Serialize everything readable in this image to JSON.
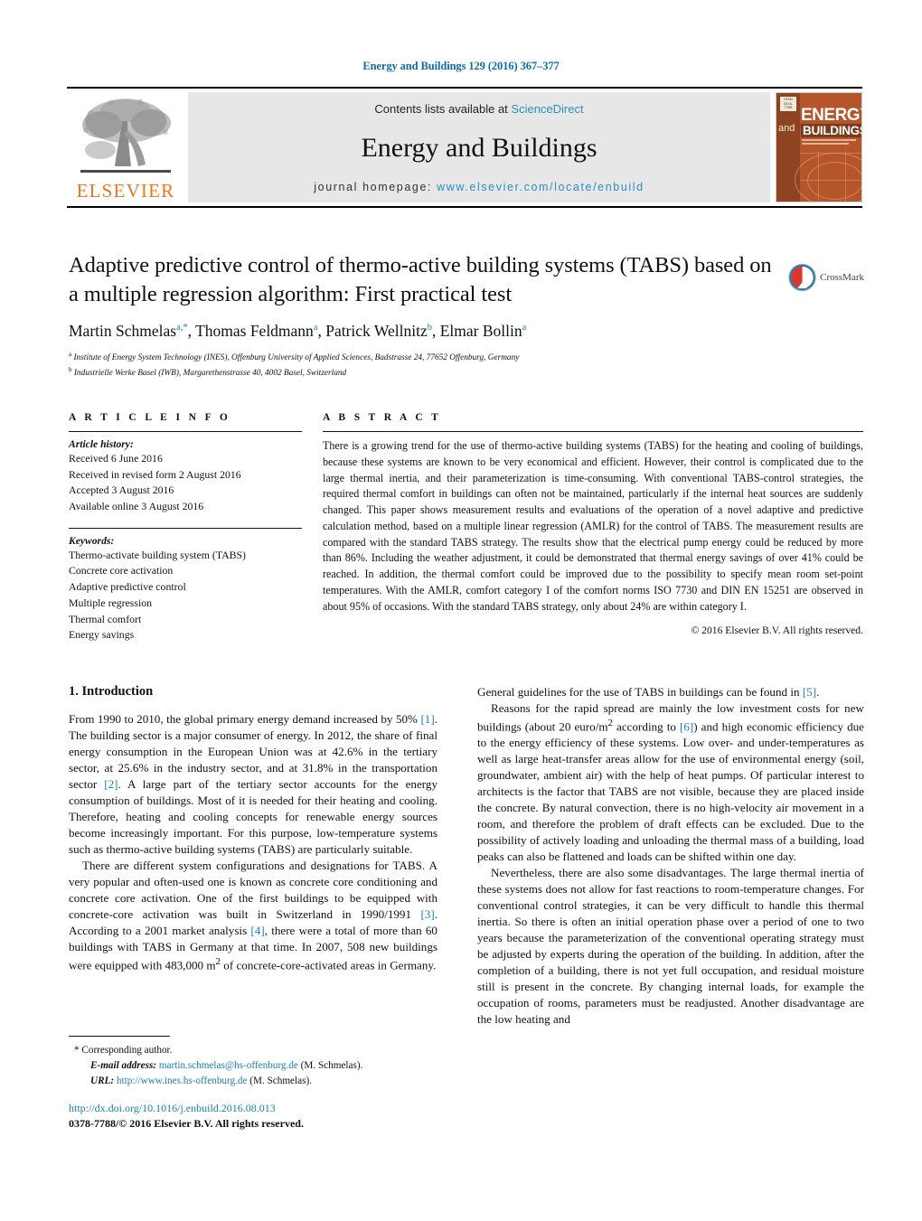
{
  "running_head": "Energy and Buildings 129 (2016) 367–377",
  "masthead": {
    "contents_prefix": "Contents lists available at ",
    "sciencedirect": "ScienceDirect",
    "journal_name": "Energy and Buildings",
    "homepage_label": "journal homepage: ",
    "homepage_url": "www.elsevier.com/locate/enbuild",
    "publisher": "ELSEVIER",
    "cover": {
      "and": "and",
      "energy": "ENERGY",
      "buildings": "BUILDINGS",
      "badge": "ISSN 0378-7788"
    },
    "accent_orange": "#E87722",
    "accent_link": "#2a8fc4"
  },
  "article": {
    "title": "Adaptive predictive control of thermo-active building systems (TABS) based on a multiple regression algorithm: First practical test",
    "authors": [
      {
        "name": "Martin Schmelas",
        "marks": "a,*"
      },
      {
        "name": "Thomas Feldmann",
        "marks": "a"
      },
      {
        "name": "Patrick Wellnitz",
        "marks": "b"
      },
      {
        "name": "Elmar Bollin",
        "marks": "a"
      }
    ],
    "affiliations": [
      {
        "mark": "a",
        "text": "Institute of Energy System Technology (INES), Offenburg University of Applied Sciences, Badstrasse 24, 77652 Offenburg, Germany"
      },
      {
        "mark": "b",
        "text": "Industrielle Werke Basel (IWB), Margarethenstrasse 40, 4002 Basel, Switzerland"
      }
    ],
    "crossmark_label": "CrossMark"
  },
  "article_info": {
    "section_label": "A R T I C L E   I N F O",
    "history_label": "Article history:",
    "history": [
      "Received 6 June 2016",
      "Received in revised form 2 August 2016",
      "Accepted 3 August 2016",
      "Available online 3 August 2016"
    ],
    "keywords_label": "Keywords:",
    "keywords": [
      "Thermo-activate building system (TABS)",
      "Concrete core activation",
      "Adaptive predictive control",
      "Multiple regression",
      "Thermal comfort",
      "Energy savings"
    ]
  },
  "abstract": {
    "section_label": "A B S T R A C T",
    "text": "There is a growing trend for the use of thermo-active building systems (TABS) for the heating and cooling of buildings, because these systems are known to be very economical and efficient. However, their control is complicated due to the large thermal inertia, and their parameterization is time-consuming. With conventional TABS-control strategies, the required thermal comfort in buildings can often not be maintained, particularly if the internal heat sources are suddenly changed. This paper shows measurement results and evaluations of the operation of a novel adaptive and predictive calculation method, based on a multiple linear regression (AMLR) for the control of TABS. The measurement results are compared with the standard TABS strategy. The results show that the electrical pump energy could be reduced by more than 86%. Including the weather adjustment, it could be demonstrated that thermal energy savings of over 41% could be reached. In addition, the thermal comfort could be improved due to the possibility to specify mean room set-point temperatures. With the AMLR, comfort category I of the comfort norms ISO 7730 and DIN EN 15251 are observed in about 95% of occasions. With the standard TABS strategy, only about 24% are within category I.",
    "copyright": "© 2016 Elsevier B.V. All rights reserved."
  },
  "body": {
    "section_number_title": "1.  Introduction",
    "left_paragraphs": [
      "From 1990 to 2010, the global primary energy demand increased by 50% [1]. The building sector is a major consumer of energy. In 2012, the share of final energy consumption in the European Union was at 42.6% in the tertiary sector, at 25.6% in the industry sector, and at 31.8% in the transportation sector [2]. A large part of the tertiary sector accounts for the energy consumption of buildings. Most of it is needed for their heating and cooling. Therefore, heating and cooling concepts for renewable energy sources become increasingly important. For this purpose, low-temperature systems such as thermo-active building systems (TABS) are particularly suitable.",
      "There are different system configurations and designations for TABS. A very popular and often-used one is known as concrete core conditioning and concrete core activation. One of the first buildings to be equipped with concrete-core activation was built in Switzerland in 1990/1991 [3]. According to a 2001 market analysis [4], there were a total of more than 60 buildings with TABS in Germany at that time. In 2007, 508 new buildings were equipped with 483,000 m2 of concrete-core-activated areas in Germany."
    ],
    "right_paragraphs": [
      "General guidelines for the use of TABS in buildings can be found in [5].",
      "Reasons for the rapid spread are mainly the low investment costs for new buildings (about 20 euro/m2 according to [6]) and high economic efficiency due to the energy efficiency of these systems. Low over- and under-temperatures as well as large heat-transfer areas allow for the use of environmental energy (soil, groundwater, ambient air) with the help of heat pumps. Of particular interest to architects is the factor that TABS are not visible, because they are placed inside the concrete. By natural convection, there is no high-velocity air movement in a room, and therefore the problem of draft effects can be excluded. Due to the possibility of actively loading and unloading the thermal mass of a building, load peaks can also be flattened and loads can be shifted within one day.",
      "Nevertheless, there are also some disadvantages. The large thermal inertia of these systems does not allow for fast reactions to room-temperature changes. For conventional control strategies, it can be very difficult to handle this thermal inertia. So there is often an initial operation phase over a period of one to two years because the parameterization of the conventional operating strategy must be adjusted by experts during the operation of the building. In addition, after the completion of a building, there is not yet full occupation, and residual moisture still is present in the concrete. By changing internal loads, for example the occupation of rooms, parameters must be readjusted. Another disadvantage are the low heating and"
    ]
  },
  "footnote": {
    "corresponding": "* Corresponding author.",
    "email_label": "E-mail address:",
    "email": "martin.schmelas@hs-offenburg.de",
    "email_suffix": "(M. Schmelas).",
    "url_label": "URL:",
    "url": "http://www.ines.hs-offenburg.de",
    "url_suffix": "(M. Schmelas)."
  },
  "doi": {
    "url": "http://dx.doi.org/10.1016/j.enbuild.2016.08.013",
    "issn_line": "0378-7788/© 2016 Elsevier B.V. All rights reserved."
  }
}
